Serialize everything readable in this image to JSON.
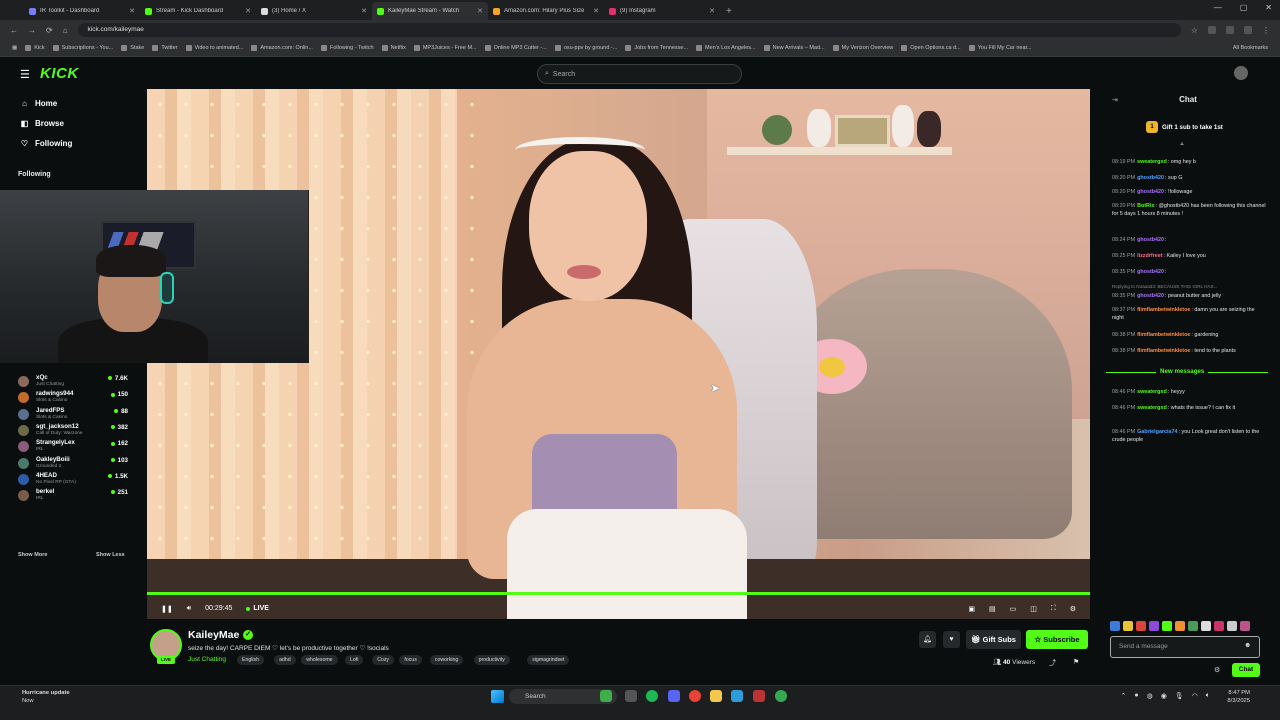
{
  "browser": {
    "tabs": [
      {
        "label": "IR Toolkit - Dashboard",
        "color": "#7a7cff",
        "active": false
      },
      {
        "label": "Stream - Kick Dashboard",
        "color": "#53fc18",
        "active": false
      },
      {
        "label": "(3) Home / X",
        "color": "#dddddd",
        "active": false
      },
      {
        "label": "KaileyMae Stream - Watch",
        "color": "#53fc18",
        "active": true
      },
      {
        "label": "Amazon.com: Hilary Plus Size",
        "color": "#f6a623",
        "active": false
      },
      {
        "label": "(9) Instagram",
        "color": "#e1306c",
        "active": false
      }
    ],
    "new_tab": "+",
    "url": "kick.com/kaileymae",
    "bookmarks": [
      "Kick",
      "Subscriptions - You...",
      "Stake",
      "Twitter",
      "Video to animated...",
      "Amazon.com: Onlin...",
      "Following - Twitch",
      "Netflix",
      "MP3Juices - Free M...",
      "Online MP3 Cutter -...",
      "osu-ppv by ground -...",
      "Jobs from Tennesse...",
      "Men's Los Angeles...",
      "New Arrivals – Mad...",
      "My Verizon Overview",
      "Open Options.ca d...",
      "You Fill My Car near..."
    ],
    "all_bookmarks": "All Bookmarks"
  },
  "kick": {
    "logo": "KICK",
    "search_placeholder": "Search"
  },
  "sidebar": {
    "nav": [
      {
        "label": "Home",
        "icon": "home-icon",
        "glyph": "⌂"
      },
      {
        "label": "Browse",
        "icon": "browse-icon",
        "glyph": "◧"
      },
      {
        "label": "Following",
        "icon": "heart-icon",
        "glyph": "♡"
      }
    ],
    "following_title": "Following",
    "following": [
      {
        "name": "xQc",
        "category": "Just Chatting",
        "viewers": "7.6K",
        "color": "#8a6b5b"
      },
      {
        "name": "radwings944",
        "category": "Slots & Casino",
        "viewers": "150",
        "color": "#c46b28"
      },
      {
        "name": "JaredFPS",
        "category": "Slots & Casino",
        "viewers": "88",
        "color": "#5b6e8a"
      },
      {
        "name": "sgt_jackson12",
        "category": "Call of Duty: Warzone",
        "viewers": "382",
        "color": "#6b6b4a"
      },
      {
        "name": "StrangelyLex",
        "category": "IRL",
        "viewers": "162",
        "color": "#8a5b7a"
      },
      {
        "name": "OakleyBoiii",
        "category": "Grounded 2",
        "viewers": "103",
        "color": "#4a7a6b"
      },
      {
        "name": "4HEAD",
        "category": "No Pixel RP (GTA)",
        "viewers": "1.5K",
        "color": "#2a5caa"
      },
      {
        "name": "berkel",
        "category": "IRL",
        "viewers": "251",
        "color": "#7a5b4a"
      }
    ],
    "show_more": "Show More",
    "show_less": "Show Less"
  },
  "player": {
    "time": "00:29:45",
    "live_label": "LIVE",
    "progress_fraction": 1.0
  },
  "stream": {
    "streamer": "KaileyMae",
    "live_badge": "LIVE",
    "title": "seize the day! CARPE DIEM ♡ let's be productive together ♡ !socials",
    "category": "Just Chatting",
    "tags": [
      "English",
      "adhd",
      "wholesome",
      "Lofi",
      "Cozy",
      "focus",
      "coworking",
      "productivity",
      "sigmagrindset"
    ],
    "gift_label": "Gift Subs",
    "subscribe_label": "Subscribe",
    "viewers_count": "40",
    "viewers_label": "Viewers"
  },
  "chat": {
    "title": "Chat",
    "gift_banner": "Gift 1 sub to take 1st",
    "gift_number": "1",
    "new_messages_label": "New messages",
    "messages": [
      {
        "time": "08:19 PM",
        "user": "sweatergxd",
        "color": "#53fc18",
        "text": "omg hey b"
      },
      {
        "time": "08:20 PM",
        "user": "ghostb420",
        "color": "#4aa3ff",
        "text": "sup G"
      },
      {
        "time": "08:20 PM",
        "user": "ghostb420",
        "color": "#a970ff",
        "text": "!followage"
      },
      {
        "time": "08:20 PM",
        "user": "BotRix",
        "color": "#53fc18",
        "text": "@ghostb420 has been following this channel for 5 days 1 hours 8 minutes !"
      },
      {
        "time": "08:24 PM",
        "user": "ghostb420",
        "color": "#a970ff",
        "text": ""
      },
      {
        "time": "08:25 PM",
        "user": "lizzdrfreet",
        "color": "#ff6b8a",
        "text": "Kailey I love you"
      },
      {
        "time": "08:35 PM",
        "user": "ghostb420",
        "color": "#a970ff",
        "text": ""
      },
      {
        "time": "",
        "user": "",
        "color": "#888888",
        "text": "Replying to Noaaa33: BECAUSE THIS GIRL HAS..."
      },
      {
        "time": "08:35 PM",
        "user": "ghostb420",
        "color": "#a970ff",
        "text": "peanut butter and jelly"
      },
      {
        "time": "08:37 PM",
        "user": "flimflambetwinkletoe",
        "color": "#ff8c42",
        "text": "damn you are seizing the night"
      },
      {
        "time": "08:38 PM",
        "user": "flimflambetwinkletoe",
        "color": "#ff8c42",
        "text": "gardening"
      },
      {
        "time": "08:38 PM",
        "user": "flimflambetwinkletoe",
        "color": "#ff8c42",
        "text": "tend to the plants"
      },
      {
        "time": "08:46 PM",
        "user": "sweatergxd",
        "color": "#53fc18",
        "text": "heyyy"
      },
      {
        "time": "08:46 PM",
        "user": "sweatergxd",
        "color": "#53fc18",
        "text": "whats the issue? I can fix it"
      },
      {
        "time": "08:46 PM",
        "user": "Gabrielgarcia74",
        "color": "#4aa3ff",
        "text": "you Look great don't listen to the crude people"
      }
    ],
    "input_placeholder": "Send a message",
    "send_label": "Chat"
  },
  "taskbar": {
    "weather_title": "Hurricane update",
    "weather_sub": "Now",
    "search_placeholder": "Search",
    "time": "8:47 PM",
    "date": "8/3/2025"
  }
}
